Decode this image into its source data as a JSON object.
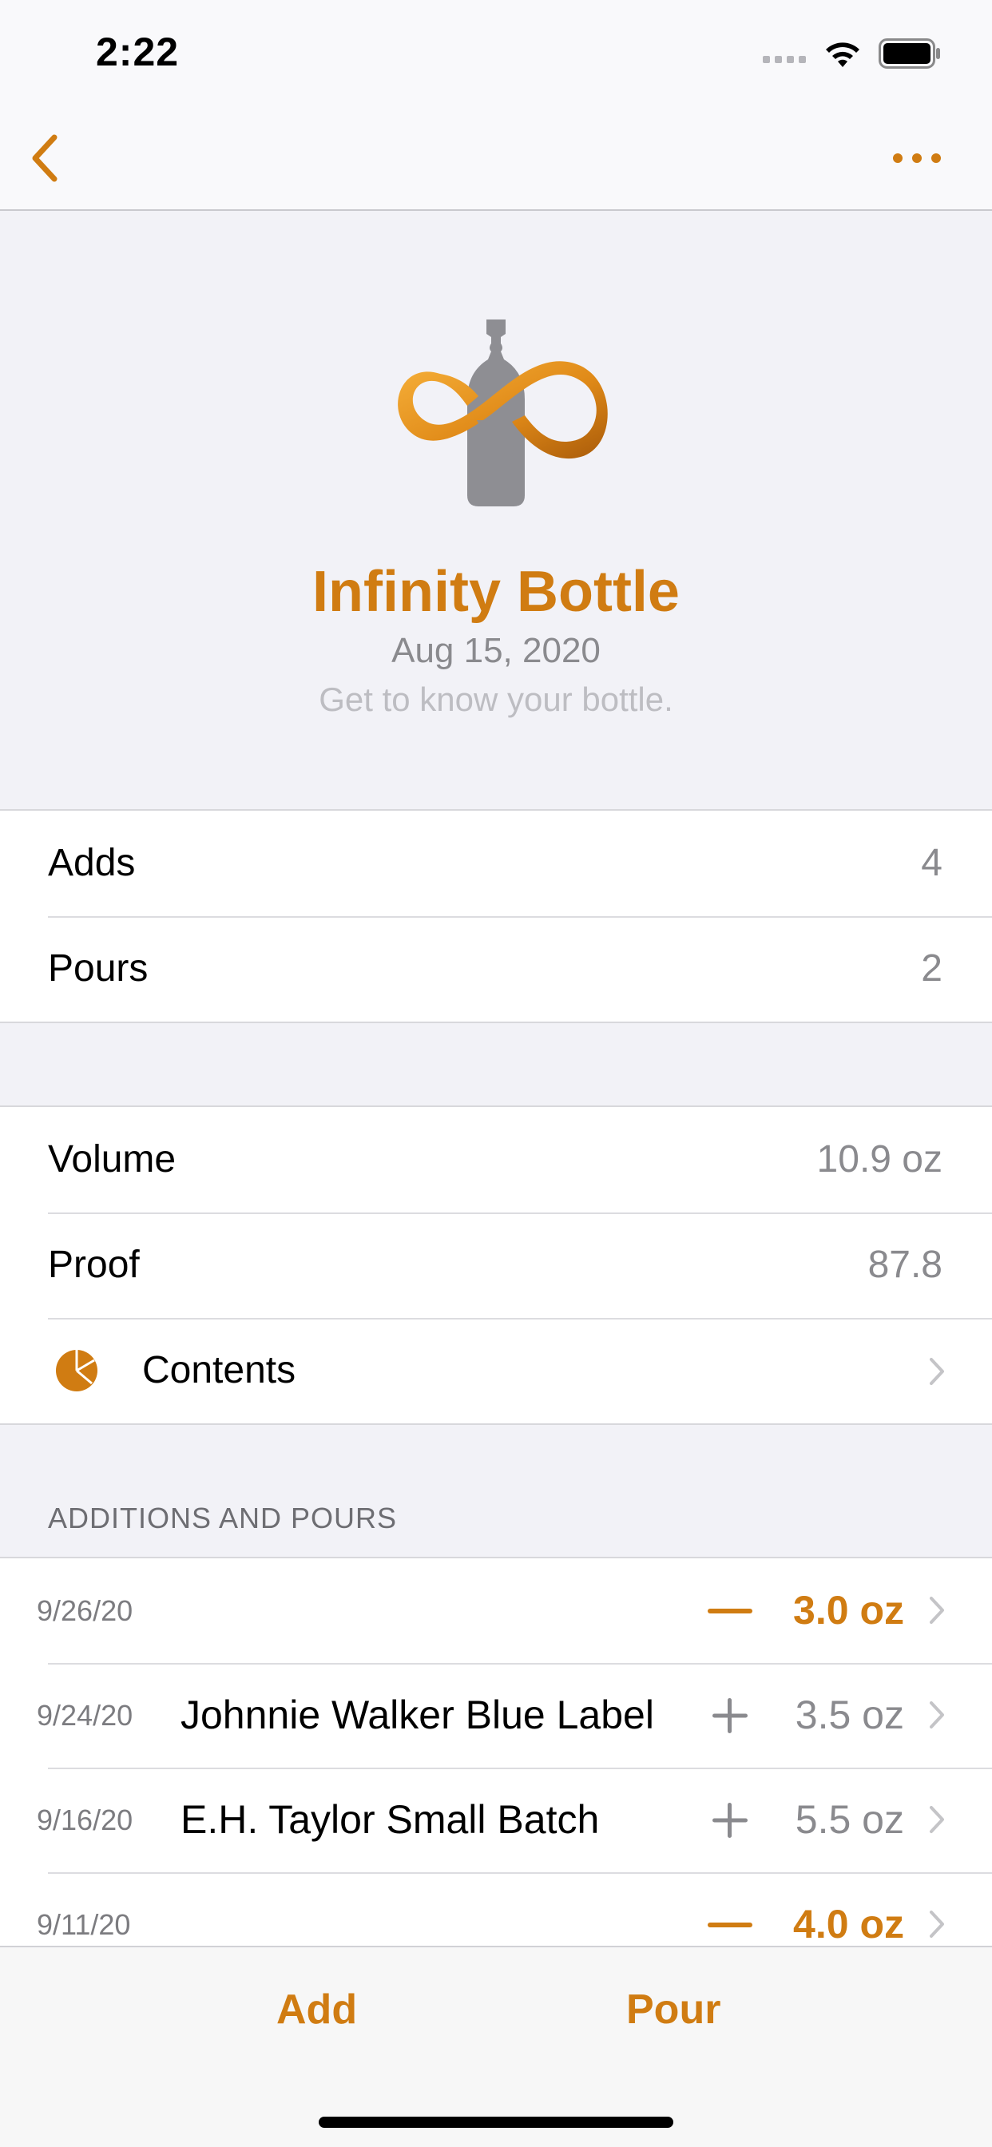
{
  "status_bar": {
    "time": "2:22"
  },
  "nav": {
    "back_icon": "chevron-left-icon",
    "more_icon": "ellipsis-icon"
  },
  "header": {
    "title": "Infinity Bottle",
    "date": "Aug 15, 2020",
    "subtitle": "Get to know your bottle."
  },
  "counts": [
    {
      "label": "Adds",
      "value": "4"
    },
    {
      "label": "Pours",
      "value": "2"
    }
  ],
  "details": {
    "volume": {
      "label": "Volume",
      "value": "10.9 oz"
    },
    "proof": {
      "label": "Proof",
      "value": "87.8"
    },
    "contents": {
      "label": "Contents"
    }
  },
  "history": {
    "section_title": "ADDITIONS AND POURS",
    "rows": [
      {
        "date": "9/26/20",
        "name": "",
        "type": "pour",
        "amount": "3.0 oz"
      },
      {
        "date": "9/24/20",
        "name": "Johnnie Walker Blue Label",
        "type": "add",
        "amount": "3.5 oz"
      },
      {
        "date": "9/16/20",
        "name": "E.H. Taylor Small Batch",
        "type": "add",
        "amount": "5.5 oz"
      },
      {
        "date": "9/11/20",
        "name": "",
        "type": "pour",
        "amount": "4.0 oz"
      }
    ]
  },
  "toolbar": {
    "add_label": "Add",
    "pour_label": "Pour"
  },
  "colors": {
    "accent": "#D07C12",
    "secondary_text": "#8A8A8E",
    "background": "#F2F2F7"
  }
}
